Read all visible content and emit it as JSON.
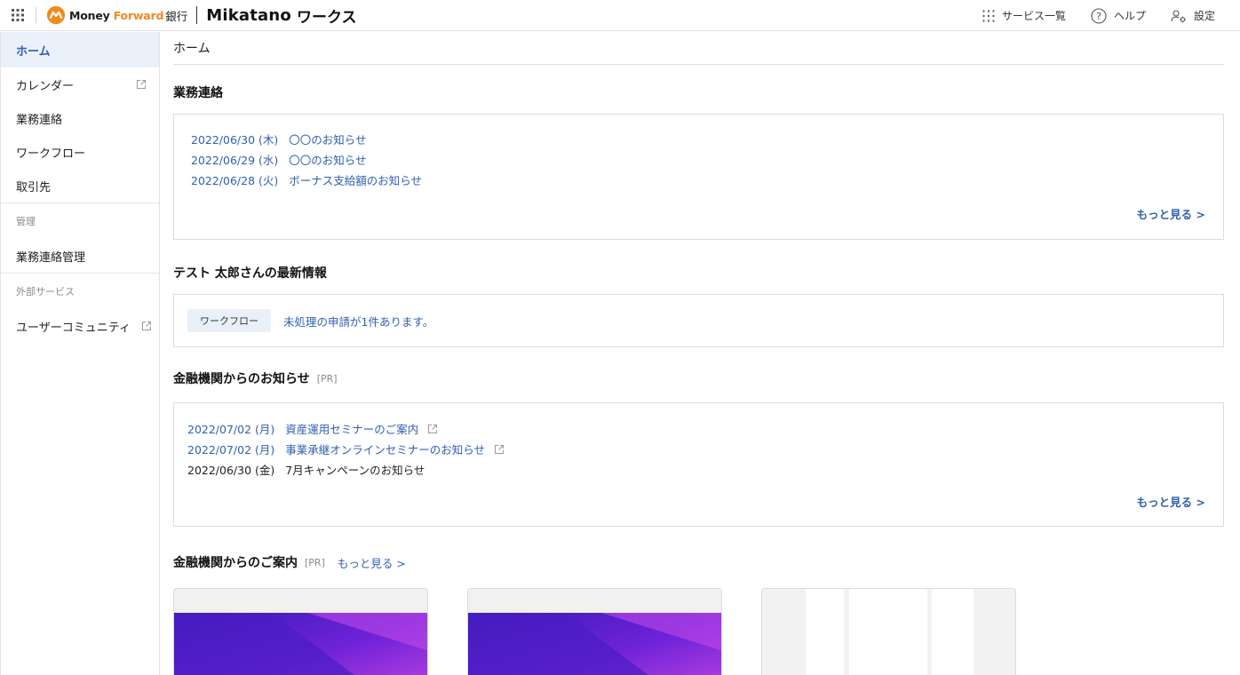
{
  "header": {
    "brand_money": "Money ",
    "brand_forward": "Forward",
    "brand_bank": "銀行",
    "brand_mikatano": "Mikatano",
    "brand_works": "ワークス",
    "service_list_label": "サービス一覧",
    "help_label": "ヘルプ",
    "settings_label": "設定"
  },
  "sidebar": {
    "items": [
      {
        "label": "ホーム"
      },
      {
        "label": "カレンダー"
      },
      {
        "label": "業務連絡"
      },
      {
        "label": "ワークフロー"
      },
      {
        "label": "取引先"
      }
    ],
    "group_admin": "管理",
    "admin_item": "業務連絡管理",
    "group_external": "外部サービス",
    "external_item": "ユーザーコミュニティ"
  },
  "main": {
    "page_title": "ホーム",
    "announcements": {
      "title": "業務連絡",
      "items": [
        {
          "date": "2022/06/30 (木)",
          "text": "〇〇のお知らせ"
        },
        {
          "date": "2022/06/29 (水)",
          "text": "〇〇のお知らせ"
        },
        {
          "date": "2022/06/28 (火)",
          "text": "ボーナス支給額のお知らせ"
        }
      ],
      "more": "もっと見る >"
    },
    "latest": {
      "title": "テスト 太郎さんの最新情報",
      "tag": "ワークフロー",
      "text": "未処理の申請が1件あります。"
    },
    "bank_news": {
      "title": "金融機関からのお知らせ",
      "pr": "[PR]",
      "items": [
        {
          "date": "2022/07/02 (月)",
          "text": "資産運用セミナーのご案内"
        },
        {
          "date": "2022/07/02 (月)",
          "text": "事業承継オンラインセミナーのお知らせ"
        },
        {
          "date": "2022/06/30 (金)",
          "text": "7月キャンペーンのお知らせ"
        }
      ],
      "more": "もっと見る >"
    },
    "bank_guide": {
      "title": "金融機関からのご案内",
      "pr": "[PR]",
      "more": "もっと見る >"
    }
  },
  "colors": {
    "accent": "#2f5fb3",
    "active_bg": "#eaf1fb",
    "brand_orange": "#f08a1e",
    "promo_purple": "#6a1fd6"
  }
}
